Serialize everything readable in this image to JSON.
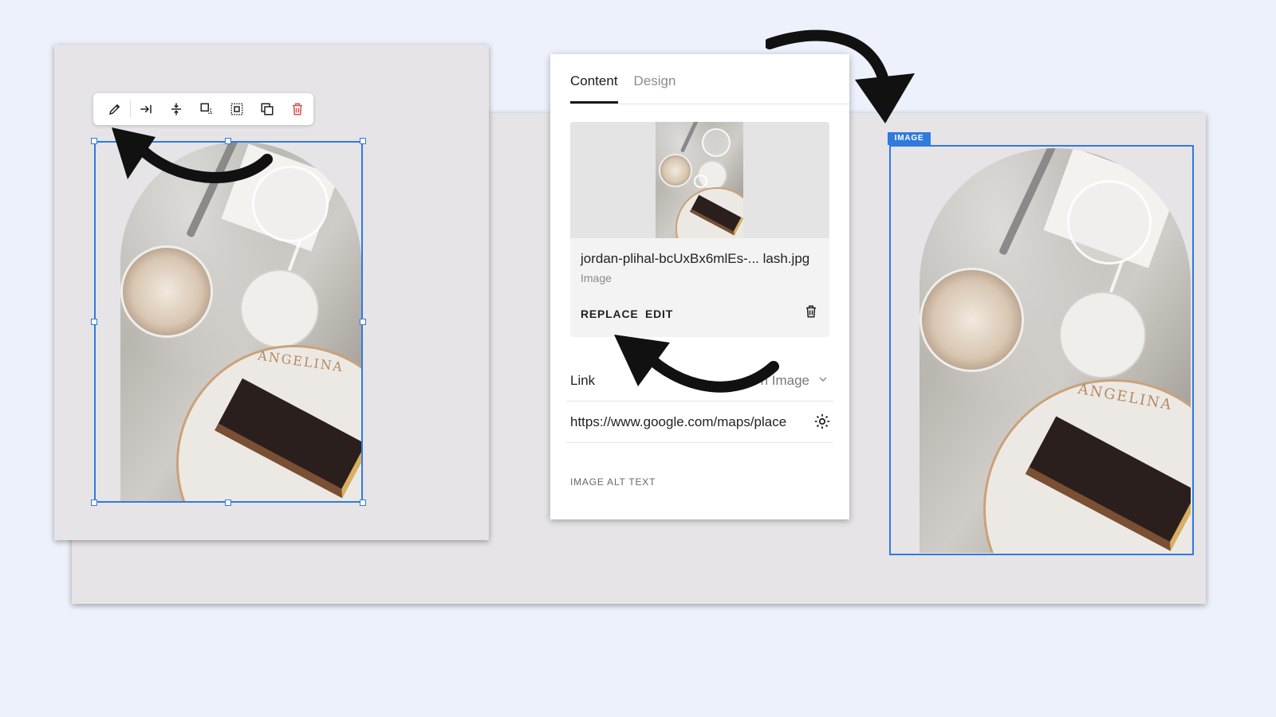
{
  "toolbar": {
    "icons": [
      "pencil-icon",
      "arrow-right-to-bar-icon",
      "align-vertical-center-icon",
      "crop-icon",
      "dashed-select-icon",
      "duplicate-icon",
      "trash-icon"
    ],
    "delete_color": "#d9534f"
  },
  "panel": {
    "tabs": [
      "Content",
      "Design"
    ],
    "active_tab": "Content",
    "file_name": "jordan-plihal-bcUxBx6mlEs-... lash.jpg",
    "file_type": "Image",
    "replace_label": "REPLACE",
    "edit_label": "EDIT",
    "link_label": "Link",
    "link_type": "n Image",
    "link_url": "https://www.google.com/maps/place",
    "alt_text_label": "IMAGE ALT TEXT"
  },
  "right_block": {
    "badge": "IMAGE",
    "accent_color": "#2f7bdc"
  },
  "photo": {
    "brand_text": "ANGELINA"
  }
}
